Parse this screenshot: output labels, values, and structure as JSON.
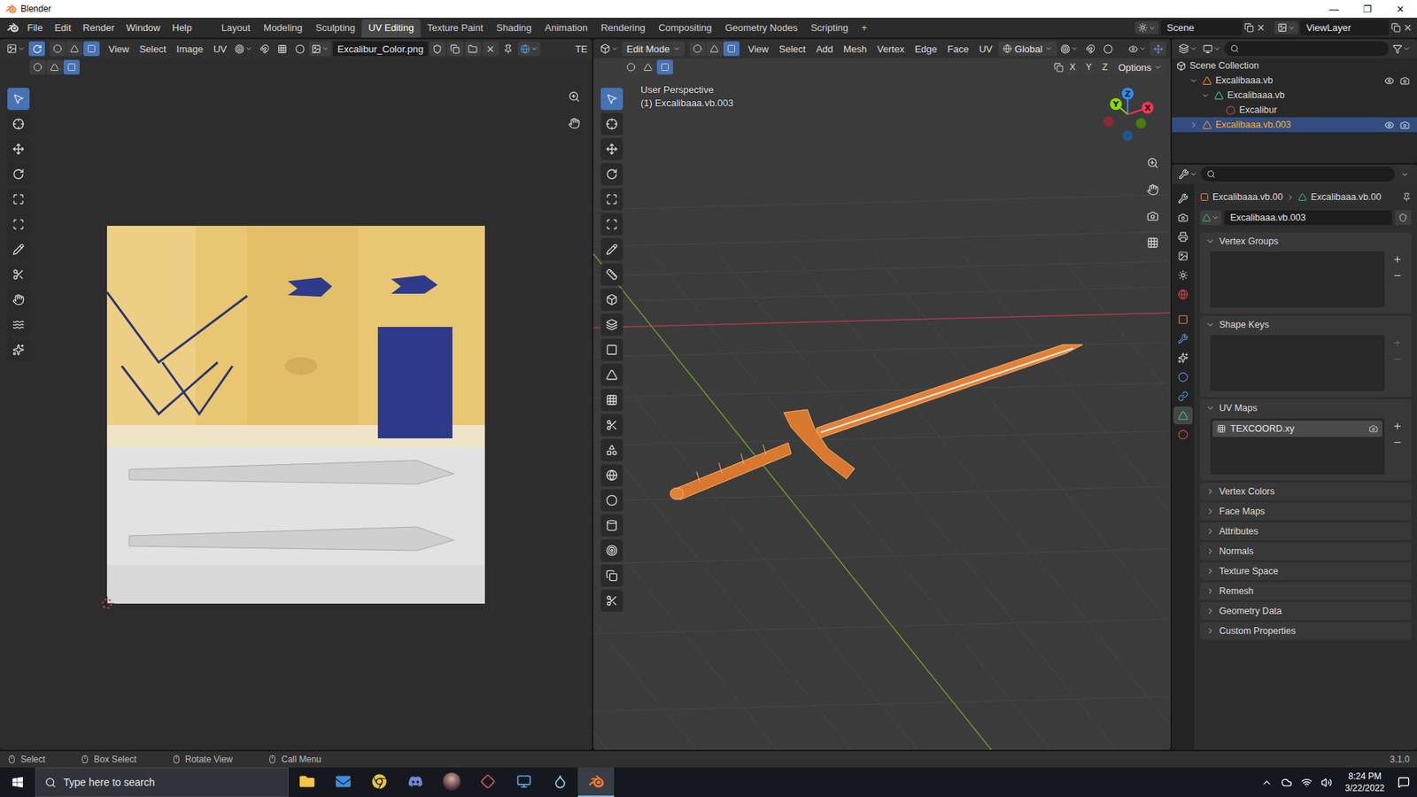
{
  "window": {
    "title": "Blender",
    "controls": [
      "—",
      "❐",
      "✕"
    ]
  },
  "topbar": {
    "menus": [
      "File",
      "Edit",
      "Render",
      "Window",
      "Help"
    ],
    "workspaces": [
      {
        "label": "Layout",
        "selected": false
      },
      {
        "label": "Modeling",
        "selected": false
      },
      {
        "label": "Sculpting",
        "selected": false
      },
      {
        "label": "UV Editing",
        "selected": true
      },
      {
        "label": "Texture Paint",
        "selected": false
      },
      {
        "label": "Shading",
        "selected": false
      },
      {
        "label": "Animation",
        "selected": false
      },
      {
        "label": "Rendering",
        "selected": false
      },
      {
        "label": "Compositing",
        "selected": false
      },
      {
        "label": "Geometry Nodes",
        "selected": false
      },
      {
        "label": "Scripting",
        "selected": false
      }
    ],
    "add_workspace": "+",
    "scene": "Scene",
    "view_layer": "ViewLayer"
  },
  "uv_editor": {
    "menus": [
      "View",
      "Select",
      "Image",
      "UV"
    ],
    "image_name": "Excalibur_Color.png",
    "cut_label": "TE",
    "sync_selection": true,
    "select_mode": [
      {
        "kind": "vertex",
        "selected": false
      },
      {
        "kind": "edge",
        "selected": false
      },
      {
        "kind": "face",
        "selected": true
      }
    ],
    "tools": [
      {
        "kind": "select",
        "selected": true
      },
      {
        "kind": "cursor",
        "selected": false
      },
      {
        "kind": "move",
        "selected": false
      },
      {
        "kind": "rotate",
        "selected": false
      },
      {
        "kind": "scale",
        "selected": false
      },
      {
        "kind": "transform",
        "selected": false
      },
      {
        "kind": "annotate",
        "selected": false
      },
      {
        "kind": "rip",
        "selected": false
      },
      {
        "kind": "grab",
        "selected": false
      },
      {
        "kind": "relax",
        "selected": false
      },
      {
        "kind": "pinch",
        "selected": false
      }
    ]
  },
  "viewport": {
    "mode": "Edit Mode",
    "menus": [
      "View",
      "Select",
      "Add",
      "Mesh",
      "Vertex",
      "Edge",
      "Face",
      "UV"
    ],
    "orientation": "Global",
    "select_mode": [
      {
        "kind": "vertex",
        "selected": false
      },
      {
        "kind": "edge",
        "selected": false
      },
      {
        "kind": "face",
        "selected": true
      }
    ],
    "mirror_axes": [
      {
        "label": "X",
        "on": false
      },
      {
        "label": "Y",
        "on": false
      },
      {
        "label": "Z",
        "on": false
      }
    ],
    "options": "Options",
    "info": [
      "User Perspective",
      "(1) Excalibaaa.vb.003"
    ],
    "gizmo_axes": [
      "X",
      "Y",
      "Z"
    ],
    "tools": [
      {
        "kind": "select",
        "selected": true
      },
      {
        "kind": "cursor",
        "selected": false
      },
      {
        "kind": "move",
        "selected": false
      },
      {
        "kind": "rotate",
        "selected": false
      },
      {
        "kind": "scale",
        "selected": false
      },
      {
        "kind": "transform",
        "selected": false
      },
      {
        "kind": "annotate",
        "selected": false
      },
      {
        "kind": "measure",
        "selected": false
      },
      {
        "kind": "add_cube",
        "selected": false
      },
      {
        "kind": "extrude",
        "selected": false
      },
      {
        "kind": "inset",
        "selected": false
      },
      {
        "kind": "bevel",
        "selected": false
      },
      {
        "kind": "loop_cut",
        "selected": false
      },
      {
        "kind": "knife",
        "selected": false
      },
      {
        "kind": "poly_build",
        "selected": false
      },
      {
        "kind": "spin",
        "selected": false
      },
      {
        "kind": "smooth",
        "selected": false
      },
      {
        "kind": "edge_slide",
        "selected": false
      },
      {
        "kind": "shrink",
        "selected": false
      },
      {
        "kind": "shear",
        "selected": false
      },
      {
        "kind": "rip",
        "selected": false
      }
    ]
  },
  "outliner": {
    "root": "Scene Collection",
    "items": [
      {
        "label": "Excalibaaa.vb",
        "depth": 1,
        "kind": "object",
        "expanded": true,
        "selected": false,
        "active": false,
        "visible": true
      },
      {
        "label": "Excalibaaa.vb",
        "depth": 2,
        "kind": "mesh",
        "expanded": true,
        "selected": false,
        "active": false
      },
      {
        "label": "Excalibur",
        "depth": 3,
        "kind": "material",
        "selected": false,
        "active": false
      },
      {
        "label": "Excalibaaa.vb.003",
        "depth": 1,
        "kind": "object",
        "expanded": false,
        "selected": true,
        "active": true,
        "visible": true
      }
    ]
  },
  "properties": {
    "breadcrumb": [
      "Excalibaaa.vb.00",
      "Excalibaaa.vb.00"
    ],
    "mesh_name": "Excalibaaa.vb.003",
    "tabs": [
      {
        "kind": "tool",
        "selected": false
      },
      {
        "kind": "render",
        "selected": false
      },
      {
        "kind": "output",
        "selected": false
      },
      {
        "kind": "view_layer",
        "selected": false
      },
      {
        "kind": "scene",
        "selected": false
      },
      {
        "kind": "world",
        "selected": false
      },
      {
        "kind": "object",
        "selected": false
      },
      {
        "kind": "modifiers",
        "selected": false
      },
      {
        "kind": "particles",
        "selected": false
      },
      {
        "kind": "physics",
        "selected": false
      },
      {
        "kind": "constraints",
        "selected": false
      },
      {
        "kind": "data",
        "selected": true
      },
      {
        "kind": "material",
        "selected": false
      }
    ],
    "panels": [
      {
        "title": "Vertex Groups",
        "expanded": true,
        "kind": "list",
        "buttons_enabled": true,
        "items": []
      },
      {
        "title": "Shape Keys",
        "expanded": true,
        "kind": "list",
        "buttons_enabled": false,
        "items": []
      },
      {
        "title": "UV Maps",
        "expanded": true,
        "kind": "list",
        "buttons_enabled": true,
        "items": [
          {
            "label": "TEXCOORD.xy",
            "selected": true
          }
        ]
      },
      {
        "title": "Vertex Colors",
        "expanded": false,
        "kind": "collapsed"
      },
      {
        "title": "Face Maps",
        "expanded": false,
        "kind": "collapsed"
      },
      {
        "title": "Attributes",
        "expanded": false,
        "kind": "collapsed"
      },
      {
        "title": "Normals",
        "expanded": false,
        "kind": "collapsed"
      },
      {
        "title": "Texture Space",
        "expanded": false,
        "kind": "collapsed"
      },
      {
        "title": "Remesh",
        "expanded": false,
        "kind": "collapsed"
      },
      {
        "title": "Geometry Data",
        "expanded": false,
        "kind": "collapsed"
      },
      {
        "title": "Custom Properties",
        "expanded": false,
        "kind": "collapsed"
      }
    ]
  },
  "status_bar": {
    "hints": [
      "Select",
      "Box Select",
      "Rotate View",
      "Call Menu"
    ],
    "version": "3.1.0"
  },
  "taskbar": {
    "search_placeholder": "Type here to search",
    "apps": [
      {
        "kind": "explorer",
        "active": false
      },
      {
        "kind": "mail",
        "active": false
      },
      {
        "kind": "chrome",
        "active": false
      },
      {
        "kind": "discord",
        "active": false
      },
      {
        "kind": "avatar",
        "active": false
      },
      {
        "kind": "game",
        "active": false
      },
      {
        "kind": "terminal",
        "active": false
      },
      {
        "kind": "notepad",
        "active": false
      },
      {
        "kind": "blender",
        "active": true
      }
    ],
    "time": "8:24 PM",
    "date": "3/22/2022"
  }
}
